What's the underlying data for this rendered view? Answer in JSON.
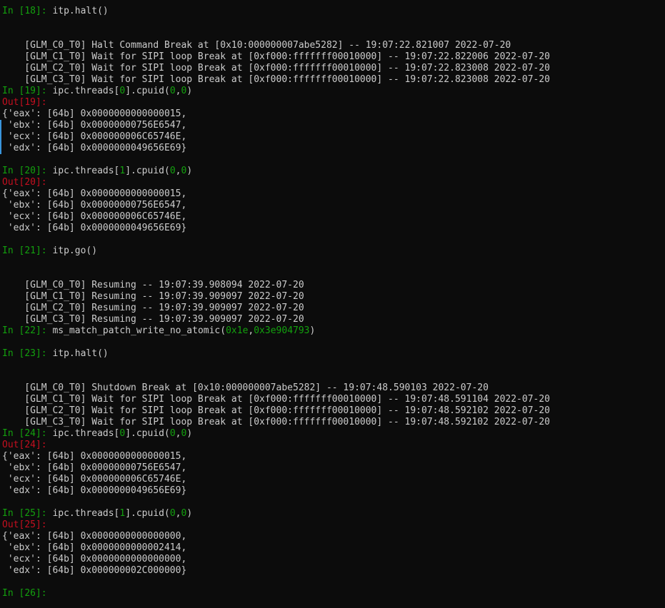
{
  "lines": [
    {
      "segs": [
        {
          "t": "In [",
          "c": "green"
        },
        {
          "t": "18",
          "c": "green"
        },
        {
          "t": "]: ",
          "c": "green"
        },
        {
          "t": "itp.halt()",
          "c": "def"
        }
      ]
    },
    {
      "segs": []
    },
    {
      "segs": []
    },
    {
      "segs": [
        {
          "t": "    [GLM_C0_T0] Halt Command Break at [0x10:000000007abe5282] -- 19:07:22.821007 2022-07-20",
          "c": "def"
        }
      ]
    },
    {
      "segs": [
        {
          "t": "    [GLM_C1_T0] Wait for SIPI loop Break at [0xf000:fffffff00010000] -- 19:07:22.822006 2022-07-20",
          "c": "def"
        }
      ]
    },
    {
      "segs": [
        {
          "t": "    [GLM_C2_T0] Wait for SIPI loop Break at [0xf000:fffffff00010000] -- 19:07:22.823008 2022-07-20",
          "c": "def"
        }
      ]
    },
    {
      "segs": [
        {
          "t": "    [GLM_C3_T0] Wait for SIPI loop Break at [0xf000:fffffff00010000] -- 19:07:22.823008 2022-07-20",
          "c": "def"
        }
      ]
    },
    {
      "segs": [
        {
          "t": "In [",
          "c": "green"
        },
        {
          "t": "19",
          "c": "green"
        },
        {
          "t": "]: ",
          "c": "green"
        },
        {
          "t": "ipc.threads[",
          "c": "def"
        },
        {
          "t": "0",
          "c": "green"
        },
        {
          "t": "].cpuid(",
          "c": "def"
        },
        {
          "t": "0",
          "c": "green"
        },
        {
          "t": ",",
          "c": "def"
        },
        {
          "t": "0",
          "c": "green"
        },
        {
          "t": ")",
          "c": "def"
        }
      ]
    },
    {
      "segs": [
        {
          "t": "Out[",
          "c": "red"
        },
        {
          "t": "19",
          "c": "red"
        },
        {
          "t": "]:",
          "c": "red"
        }
      ]
    },
    {
      "segs": [
        {
          "t": "{'eax': [64b] 0x0000000000000015,",
          "c": "def"
        }
      ]
    },
    {
      "segs": [
        {
          "t": " 'ebx': [64b] 0x00000000756E6547,",
          "c": "def"
        }
      ]
    },
    {
      "segs": [
        {
          "t": " 'ecx': [64b] 0x000000006C65746E,",
          "c": "def"
        }
      ]
    },
    {
      "segs": [
        {
          "t": " 'edx': [64b] 0x0000000049656E69}",
          "c": "def"
        }
      ]
    },
    {
      "segs": []
    },
    {
      "segs": [
        {
          "t": "In [",
          "c": "green"
        },
        {
          "t": "20",
          "c": "green"
        },
        {
          "t": "]: ",
          "c": "green"
        },
        {
          "t": "ipc.threads[",
          "c": "def"
        },
        {
          "t": "1",
          "c": "green"
        },
        {
          "t": "].cpuid(",
          "c": "def"
        },
        {
          "t": "0",
          "c": "green"
        },
        {
          "t": ",",
          "c": "def"
        },
        {
          "t": "0",
          "c": "green"
        },
        {
          "t": ")",
          "c": "def"
        }
      ]
    },
    {
      "segs": [
        {
          "t": "Out[",
          "c": "red"
        },
        {
          "t": "20",
          "c": "red"
        },
        {
          "t": "]:",
          "c": "red"
        }
      ]
    },
    {
      "segs": [
        {
          "t": "{'eax': [64b] 0x0000000000000015,",
          "c": "def"
        }
      ]
    },
    {
      "segs": [
        {
          "t": " 'ebx': [64b] 0x00000000756E6547,",
          "c": "def"
        }
      ]
    },
    {
      "segs": [
        {
          "t": " 'ecx': [64b] 0x000000006C65746E,",
          "c": "def"
        }
      ]
    },
    {
      "segs": [
        {
          "t": " 'edx': [64b] 0x0000000049656E69}",
          "c": "def"
        }
      ]
    },
    {
      "segs": []
    },
    {
      "segs": [
        {
          "t": "In [",
          "c": "green"
        },
        {
          "t": "21",
          "c": "green"
        },
        {
          "t": "]: ",
          "c": "green"
        },
        {
          "t": "itp.go()",
          "c": "def"
        }
      ]
    },
    {
      "segs": []
    },
    {
      "segs": []
    },
    {
      "segs": [
        {
          "t": "    [GLM_C0_T0] Resuming -- 19:07:39.908094 2022-07-20",
          "c": "def"
        }
      ]
    },
    {
      "segs": [
        {
          "t": "    [GLM_C1_T0] Resuming -- 19:07:39.909097 2022-07-20",
          "c": "def"
        }
      ]
    },
    {
      "segs": [
        {
          "t": "    [GLM_C2_T0] Resuming -- 19:07:39.909097 2022-07-20",
          "c": "def"
        }
      ]
    },
    {
      "segs": [
        {
          "t": "    [GLM_C3_T0] Resuming -- 19:07:39.909097 2022-07-20",
          "c": "def"
        }
      ]
    },
    {
      "segs": [
        {
          "t": "In [",
          "c": "green"
        },
        {
          "t": "22",
          "c": "green"
        },
        {
          "t": "]: ",
          "c": "green"
        },
        {
          "t": "ms_match_patch_write_no_atomic(",
          "c": "def"
        },
        {
          "t": "0x1e",
          "c": "green"
        },
        {
          "t": ",",
          "c": "def"
        },
        {
          "t": "0x3e904793",
          "c": "green"
        },
        {
          "t": ")",
          "c": "def"
        }
      ]
    },
    {
      "segs": []
    },
    {
      "segs": [
        {
          "t": "In [",
          "c": "green"
        },
        {
          "t": "23",
          "c": "green"
        },
        {
          "t": "]: ",
          "c": "green"
        },
        {
          "t": "itp.halt()",
          "c": "def"
        }
      ]
    },
    {
      "segs": []
    },
    {
      "segs": []
    },
    {
      "segs": [
        {
          "t": "    [GLM_C0_T0] Shutdown Break at [0x10:000000007abe5282] -- 19:07:48.590103 2022-07-20",
          "c": "def"
        }
      ]
    },
    {
      "segs": [
        {
          "t": "    [GLM_C1_T0] Wait for SIPI loop Break at [0xf000:fffffff00010000] -- 19:07:48.591104 2022-07-20",
          "c": "def"
        }
      ]
    },
    {
      "segs": [
        {
          "t": "    [GLM_C2_T0] Wait for SIPI loop Break at [0xf000:fffffff00010000] -- 19:07:48.592102 2022-07-20",
          "c": "def"
        }
      ]
    },
    {
      "segs": [
        {
          "t": "    [GLM_C3_T0] Wait for SIPI loop Break at [0xf000:fffffff00010000] -- 19:07:48.592102 2022-07-20",
          "c": "def"
        }
      ]
    },
    {
      "segs": [
        {
          "t": "In [",
          "c": "green"
        },
        {
          "t": "24",
          "c": "green"
        },
        {
          "t": "]: ",
          "c": "green"
        },
        {
          "t": "ipc.threads[",
          "c": "def"
        },
        {
          "t": "0",
          "c": "green"
        },
        {
          "t": "].cpuid(",
          "c": "def"
        },
        {
          "t": "0",
          "c": "green"
        },
        {
          "t": ",",
          "c": "def"
        },
        {
          "t": "0",
          "c": "green"
        },
        {
          "t": ")",
          "c": "def"
        }
      ]
    },
    {
      "segs": [
        {
          "t": "Out[",
          "c": "red"
        },
        {
          "t": "24",
          "c": "red"
        },
        {
          "t": "]:",
          "c": "red"
        }
      ]
    },
    {
      "segs": [
        {
          "t": "{'eax': [64b] 0x0000000000000015,",
          "c": "def"
        }
      ]
    },
    {
      "segs": [
        {
          "t": " 'ebx': [64b] 0x00000000756E6547,",
          "c": "def"
        }
      ]
    },
    {
      "segs": [
        {
          "t": " 'ecx': [64b] 0x000000006C65746E,",
          "c": "def"
        }
      ]
    },
    {
      "segs": [
        {
          "t": " 'edx': [64b] 0x0000000049656E69}",
          "c": "def"
        }
      ]
    },
    {
      "segs": []
    },
    {
      "segs": [
        {
          "t": "In [",
          "c": "green"
        },
        {
          "t": "25",
          "c": "green"
        },
        {
          "t": "]: ",
          "c": "green"
        },
        {
          "t": "ipc.threads[",
          "c": "def"
        },
        {
          "t": "1",
          "c": "green"
        },
        {
          "t": "].cpuid(",
          "c": "def"
        },
        {
          "t": "0",
          "c": "green"
        },
        {
          "t": ",",
          "c": "def"
        },
        {
          "t": "0",
          "c": "green"
        },
        {
          "t": ")",
          "c": "def"
        }
      ]
    },
    {
      "segs": [
        {
          "t": "Out[",
          "c": "red"
        },
        {
          "t": "25",
          "c": "red"
        },
        {
          "t": "]:",
          "c": "red"
        }
      ]
    },
    {
      "segs": [
        {
          "t": "{'eax': [64b] 0x0000000000000000,",
          "c": "def"
        }
      ]
    },
    {
      "segs": [
        {
          "t": " 'ebx': [64b] 0x0000000000002414,",
          "c": "def"
        }
      ]
    },
    {
      "segs": [
        {
          "t": " 'ecx': [64b] 0x0000000000000000,",
          "c": "def"
        }
      ]
    },
    {
      "segs": [
        {
          "t": " 'edx': [64b] 0x000000002C000000}",
          "c": "def"
        }
      ]
    },
    {
      "segs": []
    },
    {
      "segs": [
        {
          "t": "In [",
          "c": "green"
        },
        {
          "t": "26",
          "c": "green"
        },
        {
          "t": "]: ",
          "c": "green"
        }
      ]
    }
  ],
  "colors": {
    "background": "#0c0c0c",
    "default_text": "#cccccc",
    "prompt_in": "#13a10e",
    "prompt_out": "#c50f1f",
    "literal": "#13a10e",
    "selection_bar": "#3a96dd"
  }
}
